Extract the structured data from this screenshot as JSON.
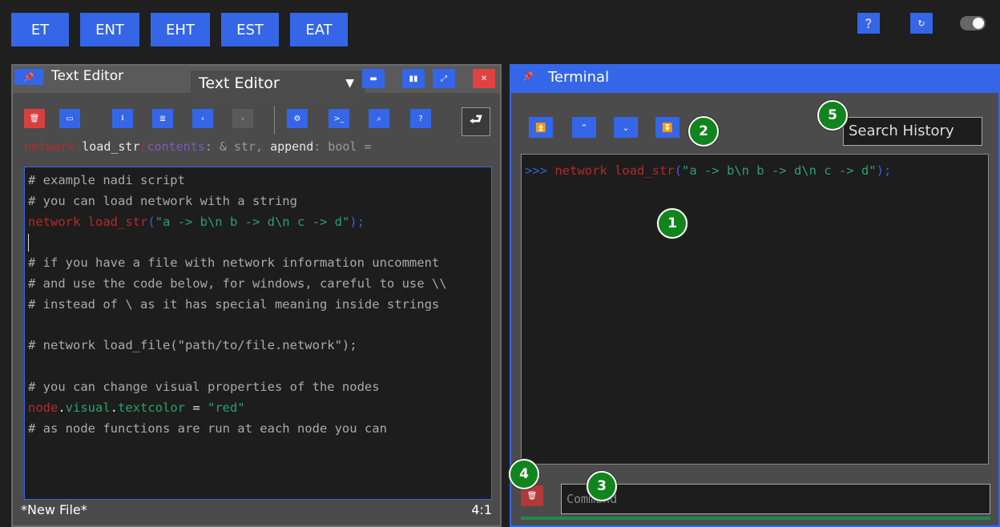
{
  "topnav": {
    "tabs": [
      "ET",
      "ENT",
      "EHT",
      "EST",
      "EAT"
    ],
    "help_icon": "question-icon",
    "refresh_icon": "refresh-icon",
    "theme_toggle": "off"
  },
  "editor_panel": {
    "title": "Text Editor",
    "selector_value": "Text Editor",
    "signature": {
      "name": "network",
      "fn": "load_str",
      "args": "contents",
      "rest": ": & str, ",
      "append": "append",
      "tail": ": bool ="
    },
    "code_lines": [
      "# example nadi script",
      "# you can load network with a string",
      "",
      "",
      "# if you have a file with network information uncomment",
      "# and use the code below, for windows, careful to use \\\\",
      "# instead of \\ as it has special meaning inside strings",
      "",
      "# network load_file(\"path/to/file.network\");",
      "",
      "# you can change visual properties of the nodes",
      "",
      "# as node functions are run at each node you can"
    ],
    "code_line3": {
      "kw": "network load_str",
      "paren": "(",
      "str": "\"a -> b\\n b -> d\\n c -> d\"",
      "end": ");"
    },
    "code_line12": {
      "obj": "node",
      "dot1": ".",
      "prop1": "visual",
      "dot2": ".",
      "prop2": "textcolor",
      "eq": " = ",
      "val": "\"red\""
    },
    "status_file": "*New File*",
    "status_pos": "4:1"
  },
  "terminal_panel": {
    "title": "Terminal",
    "search_placeholder": "Search History",
    "prompt": ">>>",
    "cmd_kw": " network load_str",
    "cmd_paren": "(",
    "cmd_str": "\"a -> b\\n b -> d\\n c -> d\"",
    "cmd_end": ");",
    "input_placeholder": "Command"
  },
  "markers": [
    "1",
    "2",
    "3",
    "4",
    "5"
  ]
}
